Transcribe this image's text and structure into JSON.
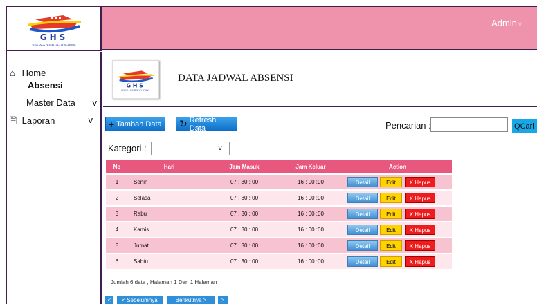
{
  "brand": {
    "logo_text": "GHS",
    "logo_subtitle": "GENTALA HOSPITALITY SCHOOL"
  },
  "header": {
    "user": "Admin",
    "caret": "v"
  },
  "sidebar": {
    "items": [
      {
        "label": "Home",
        "icon": "home-icon"
      },
      {
        "label": "Absensi"
      },
      {
        "label": "Master Data",
        "caret": "v"
      },
      {
        "label": "Laporan",
        "icon": "document-icon",
        "caret": "v"
      }
    ]
  },
  "page": {
    "title": "DATA JADWAL ABSENSI"
  },
  "toolbar": {
    "add_label": "Tambah Data",
    "add_icon": "+",
    "refresh_label": "Refresh Data",
    "refresh_icon": "refresh-icon"
  },
  "search": {
    "label": "Pencarian :",
    "value": "",
    "button_label": "Cari",
    "button_icon": "Q"
  },
  "filter": {
    "label": "Kategori :",
    "value": "",
    "arrow": "v"
  },
  "table": {
    "headers": [
      "No",
      "Hari",
      "Jam Masuk",
      "Jam Keluar",
      "Action"
    ],
    "rows": [
      {
        "no": "1",
        "hari": "Senin",
        "masuk": "07 : 30 : 00",
        "keluar": "16 : 00 :00"
      },
      {
        "no": "2",
        "hari": "Selasa",
        "masuk": "07 : 30 : 00",
        "keluar": "16 : 00 :00"
      },
      {
        "no": "3",
        "hari": "Rabu",
        "masuk": "07 : 30 : 00",
        "keluar": "16 : 00 :00"
      },
      {
        "no": "4",
        "hari": "Kamis",
        "masuk": "07 : 30 : 00",
        "keluar": "16 : 00 :00"
      },
      {
        "no": "5",
        "hari": "Jumat",
        "masuk": "07 : 30 : 00",
        "keluar": "16 : 00 :00"
      },
      {
        "no": "6",
        "hari": "Sabtu",
        "masuk": "07 : 30 : 00",
        "keluar": "16 : 00 :00"
      }
    ],
    "actions": {
      "detail": "Detail",
      "edit": "Edit",
      "hapus": "X Hapus"
    }
  },
  "footer": {
    "summary": "Jumlah 6 data , Halaman 1 Dari 1 Halaman"
  },
  "pager": {
    "first": "<",
    "prev": "< Sebelumnya",
    "next": "Berikutnya >",
    "last": ">"
  },
  "colors": {
    "header_pink": "#ef93ad",
    "table_header": "#e8577d",
    "button_blue": "#0d6fc9",
    "edit_yellow": "#ffd200",
    "delete_red": "#ee1c1c"
  }
}
